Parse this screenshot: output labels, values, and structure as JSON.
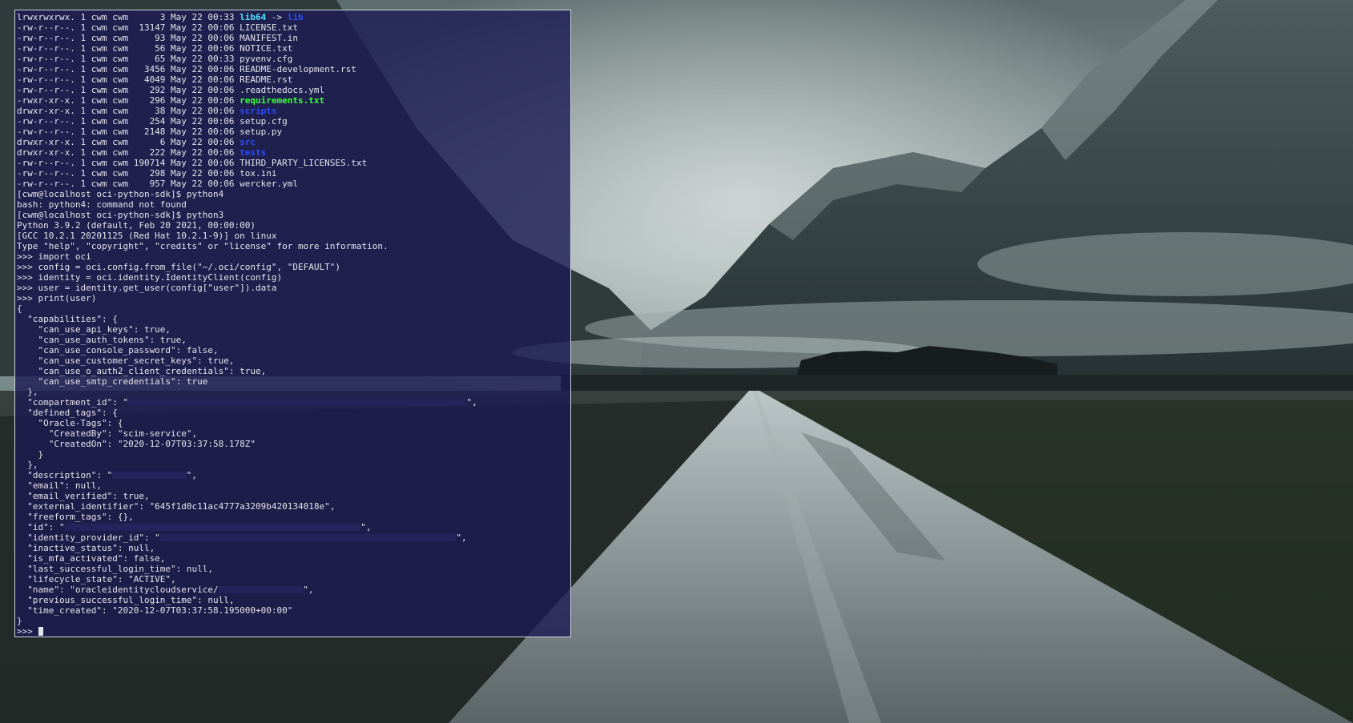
{
  "colors": {
    "terminal_bg": "#1c1a52",
    "terminal_fg": "#e4e4ec",
    "symlink": "#4ee3ff",
    "directory": "#2b4dff",
    "executable": "#39ff39"
  },
  "wallpaper": {
    "description_icon": "mountain-road-landscape"
  },
  "terminal": {
    "lines": [
      [
        {
          "text": "lrwxrwxrwx. 1 cwm cwm      3 May 22 00:33 "
        },
        {
          "text": "lib64",
          "cls": "c-cyan"
        },
        {
          "text": " -> "
        },
        {
          "text": "lib",
          "cls": "c-blue"
        }
      ],
      [
        {
          "text": "-rw-r--r--. 1 cwm cwm  13147 May 22 00:06 LICENSE.txt"
        }
      ],
      [
        {
          "text": "-rw-r--r--. 1 cwm cwm     93 May 22 00:06 MANIFEST.in"
        }
      ],
      [
        {
          "text": "-rw-r--r--. 1 cwm cwm     56 May 22 00:06 NOTICE.txt"
        }
      ],
      [
        {
          "text": "-rw-r--r--. 1 cwm cwm     65 May 22 00:33 pyvenv.cfg"
        }
      ],
      [
        {
          "text": "-rw-r--r--. 1 cwm cwm   3456 May 22 00:06 README-development.rst"
        }
      ],
      [
        {
          "text": "-rw-r--r--. 1 cwm cwm   4049 May 22 00:06 README.rst"
        }
      ],
      [
        {
          "text": "-rw-r--r--. 1 cwm cwm    292 May 22 00:06 .readthedocs.yml"
        }
      ],
      [
        {
          "text": "-rwxr-xr-x. 1 cwm cwm    296 May 22 00:06 "
        },
        {
          "text": "requirements.txt",
          "cls": "c-green"
        }
      ],
      [
        {
          "text": "drwxr-xr-x. 1 cwm cwm     38 May 22 00:06 "
        },
        {
          "text": "scripts",
          "cls": "c-blue"
        }
      ],
      [
        {
          "text": "-rw-r--r--. 1 cwm cwm    254 May 22 00:06 setup.cfg"
        }
      ],
      [
        {
          "text": "-rw-r--r--. 1 cwm cwm   2148 May 22 00:06 setup.py"
        }
      ],
      [
        {
          "text": "drwxr-xr-x. 1 cwm cwm      6 May 22 00:06 "
        },
        {
          "text": "src",
          "cls": "c-blue"
        }
      ],
      [
        {
          "text": "drwxr-xr-x. 1 cwm cwm    222 May 22 00:06 "
        },
        {
          "text": "tests",
          "cls": "c-blue"
        }
      ],
      [
        {
          "text": "-rw-r--r--. 1 cwm cwm 190714 May 22 00:06 THIRD_PARTY_LICENSES.txt"
        }
      ],
      [
        {
          "text": "-rw-r--r--. 1 cwm cwm    298 May 22 00:06 tox.ini"
        }
      ],
      [
        {
          "text": "-rw-r--r--. 1 cwm cwm    957 May 22 00:06 wercker.yml"
        }
      ],
      [
        {
          "text": "[cwm@localhost oci-python-sdk]$ python4"
        }
      ],
      [
        {
          "text": "bash: python4: command not found"
        }
      ],
      [
        {
          "text": "[cwm@localhost oci-python-sdk]$ python3"
        }
      ],
      [
        {
          "text": "Python 3.9.2 (default, Feb 20 2021, 00:00:00)"
        }
      ],
      [
        {
          "text": "[GCC 10.2.1 20201125 (Red Hat 10.2.1-9)] on linux"
        }
      ],
      [
        {
          "text": "Type \"help\", \"copyright\", \"credits\" or \"license\" for more information."
        }
      ],
      [
        {
          "text": ">>> import oci"
        }
      ],
      [
        {
          "text": ">>> config = oci.config.from_file(\"~/.oci/config\", \"DEFAULT\")"
        }
      ],
      [
        {
          "text": ">>> identity = oci.identity.IdentityClient(config)"
        }
      ],
      [
        {
          "text": ">>> user = identity.get_user(config[\"user\"]).data"
        }
      ],
      [
        {
          "text": ">>> print(user)"
        }
      ],
      [
        {
          "text": "{"
        }
      ],
      [
        {
          "text": "  \"capabilities\": {"
        }
      ],
      [
        {
          "text": "    \"can_use_api_keys\": true,"
        }
      ],
      [
        {
          "text": "    \"can_use_auth_tokens\": true,"
        }
      ],
      [
        {
          "text": "    \"can_use_console_password\": false,"
        }
      ],
      [
        {
          "text": "    \"can_use_customer_secret_keys\": true,"
        }
      ],
      [
        {
          "text": "    \"can_use_o_auth2_client_credentials\": true,"
        }
      ],
      [
        {
          "text": "    \"can_use_smtp_credentials\": true"
        }
      ],
      [
        {
          "text": "  },"
        }
      ],
      [
        {
          "text": "  \"compartment_id\": \""
        },
        {
          "redact": 64
        },
        {
          "text": "\","
        }
      ],
      [
        {
          "text": "  \"defined_tags\": {"
        }
      ],
      [
        {
          "text": "    \"Oracle-Tags\": {"
        }
      ],
      [
        {
          "text": "      \"CreatedBy\": \"scim-service\","
        }
      ],
      [
        {
          "text": "      \"CreatedOn\": \"2020-12-07T03:37:58.178Z\""
        }
      ],
      [
        {
          "text": "    }"
        }
      ],
      [
        {
          "text": "  },"
        }
      ],
      [
        {
          "text": "  \"description\": \""
        },
        {
          "redact": 14
        },
        {
          "text": "\","
        }
      ],
      [
        {
          "text": "  \"email\": null,"
        }
      ],
      [
        {
          "text": "  \"email_verified\": true,"
        }
      ],
      [
        {
          "text": "  \"external_identifier\": \"645f1d0c11ac4777a3209b420134018e\","
        }
      ],
      [
        {
          "text": "  \"freeform_tags\": {},"
        }
      ],
      [
        {
          "text": "  \"id\": \""
        },
        {
          "redact": 56
        },
        {
          "text": "\","
        }
      ],
      [
        {
          "text": "  \"identity_provider_id\": \""
        },
        {
          "redact": 56
        },
        {
          "text": "\","
        }
      ],
      [
        {
          "text": "  \"inactive_status\": null,"
        }
      ],
      [
        {
          "text": "  \"is_mfa_activated\": false,"
        }
      ],
      [
        {
          "text": "  \"last_successful_login_time\": null,"
        }
      ],
      [
        {
          "text": "  \"lifecycle_state\": \"ACTIVE\","
        }
      ],
      [
        {
          "text": "  \"name\": \"oracleidentitycloudservice/"
        },
        {
          "redact": 16
        },
        {
          "text": "\","
        }
      ],
      [
        {
          "text": "  \"previous_successful_login_time\": null,"
        }
      ],
      [
        {
          "text": "  \"time_created\": \"2020-12-07T03:37:58.195000+00:00\""
        }
      ],
      [
        {
          "text": "}"
        }
      ],
      [
        {
          "text": ">>> "
        },
        {
          "cursor": true
        }
      ]
    ]
  }
}
